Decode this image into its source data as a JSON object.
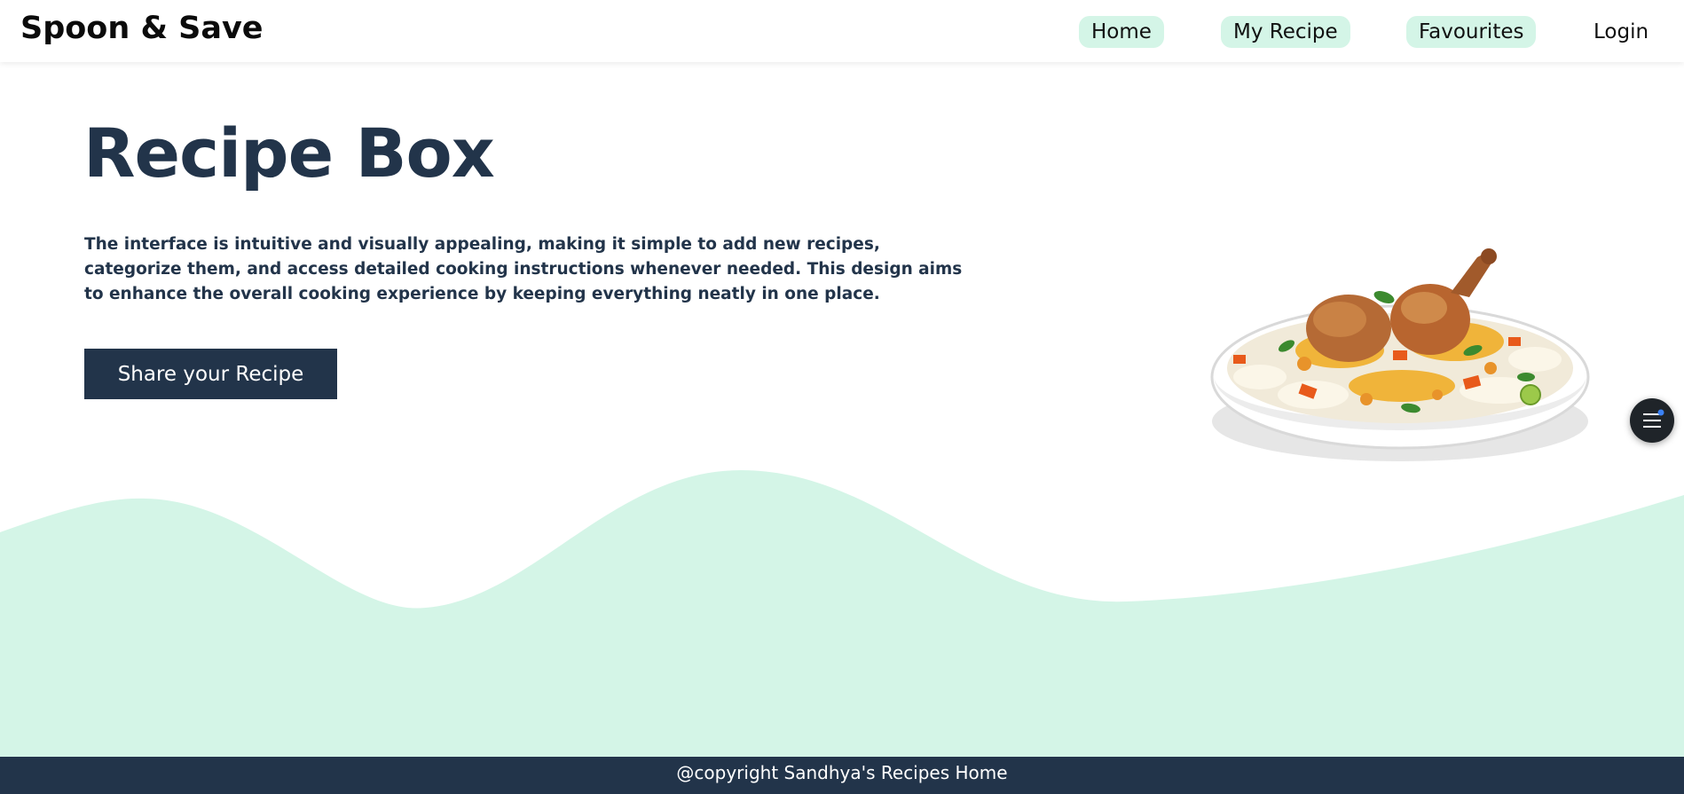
{
  "header": {
    "brand": "Spoon & Save",
    "nav": {
      "home": "Home",
      "my_recipe": "My Recipe",
      "favourites": "Favourites",
      "login": "Login"
    }
  },
  "hero": {
    "title": "Recipe Box",
    "description": "The interface is intuitive and visually appealing, making it simple to add new recipes, categorize them, and access detailed cooking instructions whenever needed. This design aims to enhance the overall cooking experience by keeping everything neatly in one place.",
    "cta_label": "Share your Recipe",
    "image": "chicken-biryani-plate"
  },
  "floating_button": {
    "icon": "menu-icon"
  },
  "footer": {
    "text": "@copyright Sandhya's Recipes Home"
  },
  "colors": {
    "primary_dark": "#22344a",
    "accent_mint": "#d4f5e7",
    "nav_text": "#111111",
    "background": "#ffffff"
  }
}
